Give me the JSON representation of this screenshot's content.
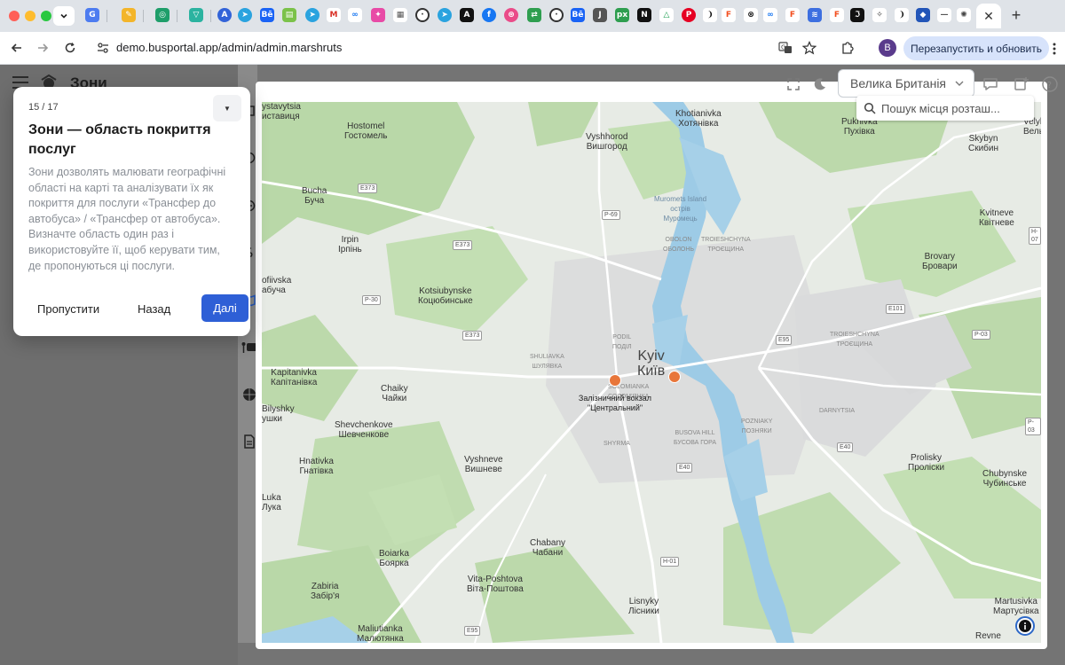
{
  "browser": {
    "url": "demo.busportal.app/admin/admin.marshruts",
    "relaunch_label": "Перезапустить и обновить",
    "profile_initial": "B",
    "colors": {
      "tab_bar": "#dfe3e8",
      "relaunch_bg": "#d7e3fb"
    }
  },
  "app": {
    "title": "Зони",
    "language": "Велика Британія",
    "search_placeholder": "Пошук місця розташ..."
  },
  "tour": {
    "step": "15 / 17",
    "title": "Зони — область покриття послуг",
    "body": "Зони дозволять малювати географічні області на карті та аналізувати їх як покриття для послуги «Трансфер до автобуса» / «Трансфер от автобуса». Визначте область один раз і використовуйте її, щоб керувати тим, де пропонуються ці послуги.",
    "skip_label": "Пропустити",
    "back_label": "Назад",
    "next_label": "Далі",
    "accent": "#2e5fd6"
  },
  "map": {
    "marker_color": "#e8763a",
    "station_label": "Залізничний вокзал \"Центральний\"",
    "places": [
      {
        "name": "ystavytsia\nиставиця"
      },
      {
        "name": "Hostomel\nГостомель"
      },
      {
        "name": "Vyshhorod\nВишгород"
      },
      {
        "name": "Khotianivka\nХотянівка"
      },
      {
        "name": "Pukhivka\nПухівка"
      },
      {
        "name": "Velykі\nВель"
      },
      {
        "name": "Skybyn\nСкибин"
      },
      {
        "name": "Bucha\nБуча"
      },
      {
        "name": "Muromets Island\nострів\nМуромець"
      },
      {
        "name": "Kvitneve\nКвітневе"
      },
      {
        "name": "Irpin\nІрпінь"
      },
      {
        "name": "Brovary\nБровари"
      },
      {
        "name": "ofiivska\nабуча"
      },
      {
        "name": "Kotsiubynske\nКоцюбинське"
      },
      {
        "name": "Kapitanivka\nКапітанівка"
      },
      {
        "name": "Chaiky\nЧайки"
      },
      {
        "name": "Bilyshky\nушки"
      },
      {
        "name": "Shevchenkove\nШевченкове"
      },
      {
        "name": "Hnativka\nГнатівка"
      },
      {
        "name": "Vyshneve\nВишневе"
      },
      {
        "name": "Prolisky\nПроліски"
      },
      {
        "name": "Chubynske\nЧубинське"
      },
      {
        "name": "Luka\nЛука"
      },
      {
        "name": "Chabany\nЧабани"
      },
      {
        "name": "Boiarka\nБоярка"
      },
      {
        "name": "Vita-Poshtova\nВіта-Поштова"
      },
      {
        "name": "Zabiria\nЗабір'я"
      },
      {
        "name": "Lisnyky\nЛісники"
      },
      {
        "name": "Martusivka\nМартусівка"
      },
      {
        "name": "Maliutianka\nМалютянка"
      },
      {
        "name": "Revne"
      }
    ],
    "districts": [
      {
        "name": "OBOLON\nОБОЛОНЬ"
      },
      {
        "name": "PODIL\nПОДІЛ"
      },
      {
        "name": "SHULIAVKA\nШУЛЯВКА"
      },
      {
        "name": "DARNYTSIA"
      },
      {
        "name": "POZNIAKY\nПОЗНЯКИ"
      },
      {
        "name": "TROIESHCHYNA\nТРОЄЩИНА"
      },
      {
        "name": "TROIESHCHYNA\nТРОЄЩИНА"
      },
      {
        "name": "SOLOMIANKA\nСОЛОМ'ЯНКА"
      },
      {
        "name": "SHYRMA"
      },
      {
        "name": "BUSOVA HILL\nБУСОВА ГОРА"
      }
    ],
    "roads": [
      "E373",
      "P-69",
      "E373",
      "P-30",
      "E373",
      "E95",
      "E101",
      "P-03",
      "H-07",
      "E40",
      "H-01",
      "E95",
      "E40",
      "P-03"
    ],
    "city": "Kyiv\nКиїв"
  }
}
